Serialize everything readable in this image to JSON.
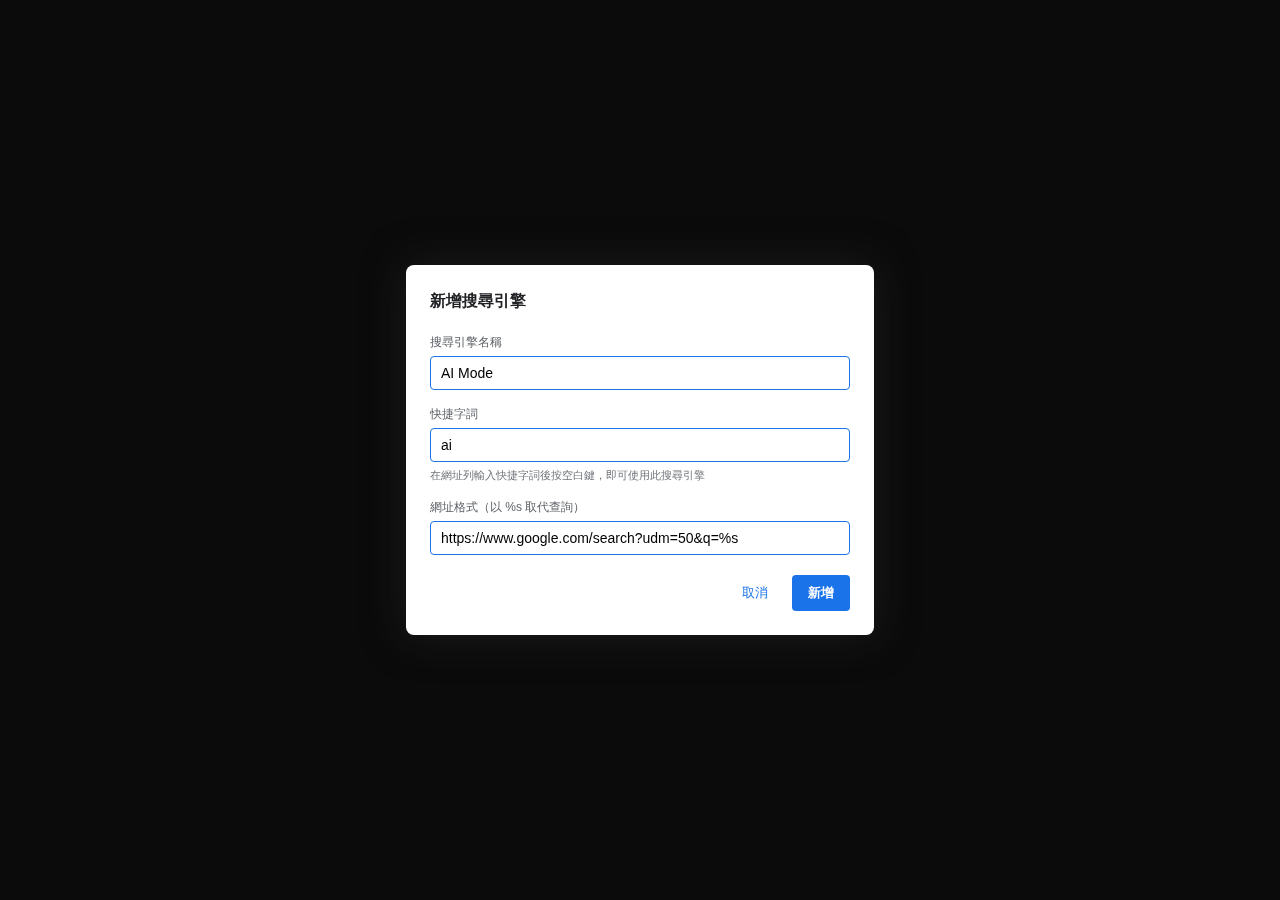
{
  "dialog": {
    "title": "新增搜尋引擎",
    "fields": [
      {
        "label": "搜尋引擎名稱",
        "value": "AI Mode"
      },
      {
        "label": "快捷字詞",
        "value": "ai",
        "hint": "在網址列輸入快捷字詞後按空白鍵，即可使用此搜尋引擎"
      },
      {
        "label": "網址格式（以 %s 取代查詢）",
        "value": "https://www.google.com/search?udm=50&q=%s"
      }
    ],
    "buttons": [
      {
        "label": "取消",
        "kind": "text"
      },
      {
        "label": "新增",
        "kind": "filled"
      }
    ]
  }
}
